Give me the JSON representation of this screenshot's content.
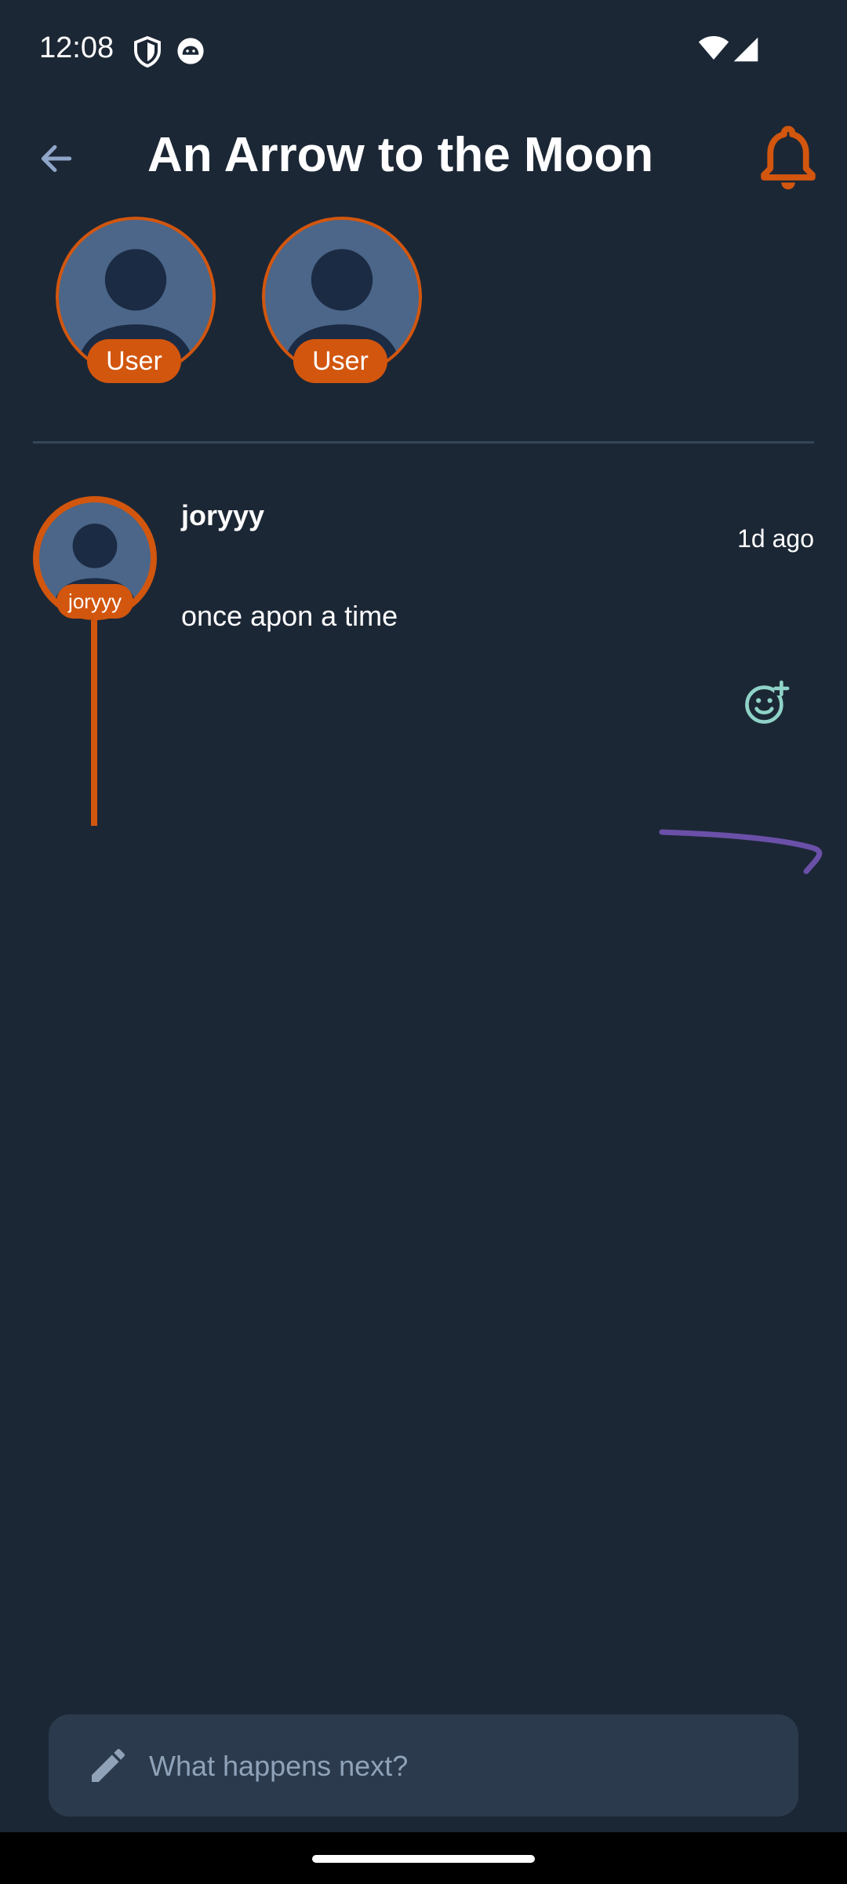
{
  "status_bar": {
    "time": "12:08",
    "icons": [
      "shield-icon",
      "android-robot-icon",
      "wifi-icon",
      "signal-icon"
    ]
  },
  "app_bar": {
    "title": "An Arrow to the Moon",
    "back_icon": "arrow-left-icon",
    "notify_icon": "bell-icon"
  },
  "participants": [
    {
      "label": "User"
    },
    {
      "label": "User"
    }
  ],
  "post": {
    "author": "joryyy",
    "avatar_label": "joryyy",
    "timestamp": "1d ago",
    "text": "once apon a time",
    "react_icon": "add-reaction-icon"
  },
  "compose": {
    "placeholder": "What happens next?",
    "icon": "pencil-icon"
  },
  "colors": {
    "background": "#1c2735",
    "accent": "#d2560e",
    "avatar_fill": "#4b6688",
    "avatar_silhouette": "#1c2b44",
    "reaction_icon": "#8fd3c8",
    "swoosh": "#6a50a8",
    "compose_bg": "#2b3b4d"
  }
}
